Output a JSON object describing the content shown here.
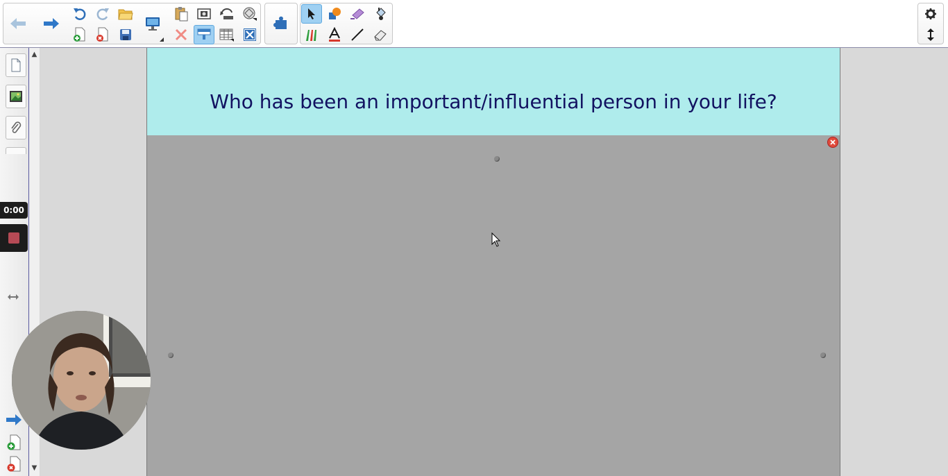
{
  "slide": {
    "title": "Who has been an important/influential person in your life?"
  },
  "recorder": {
    "time": "0:00"
  },
  "colors": {
    "title_band": "#afecec",
    "title_text": "#121261",
    "page_background": "#a5a5a5",
    "workspace": "#d9d9d9",
    "active_tool": "#9fd0f2",
    "record_button": "#b54a55"
  },
  "toolbar": {
    "active_tool": "select-tool",
    "icons": [
      "back-arrow-icon",
      "forward-arrow-icon",
      "undo-icon",
      "redo-icon",
      "open-file-icon",
      "add-page-icon",
      "delete-page-icon",
      "save-icon",
      "display-icon",
      "paste-icon",
      "screen-capture-icon",
      "screen-shade-icon",
      "document-camera-icon",
      "delete-icon",
      "screen-shade-toggle-icon",
      "table-icon",
      "fullscreen-icon",
      "add-ons-icon",
      "select-icon",
      "shapes-icon",
      "magic-pen-icon",
      "fill-icon",
      "pens-icon",
      "text-icon",
      "line-icon",
      "eraser-icon",
      "settings-icon",
      "move-toolbar-icon"
    ]
  }
}
